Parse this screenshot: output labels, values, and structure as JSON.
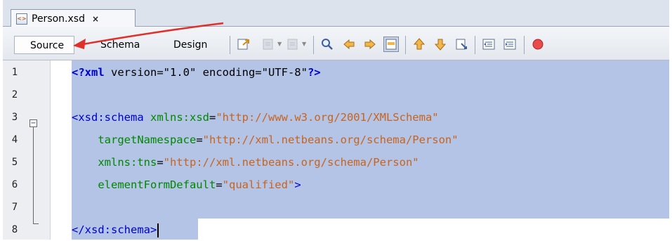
{
  "tab": {
    "title": "Person.xsd",
    "close": "×",
    "icon": "xsd-file-icon"
  },
  "toolbar": {
    "views": [
      "Source",
      "Schema",
      "Design"
    ],
    "active_view": "Source",
    "icons": [
      "go-to-source-icon",
      "back-icon",
      "forward-icon",
      "find-icon",
      "find-previous-icon",
      "find-next-icon",
      "toggle-highlight-icon",
      "previous-bookmark-icon",
      "next-bookmark-icon",
      "toggle-bookmark-icon",
      "shift-left-icon",
      "shift-right-icon",
      "record-macro-icon"
    ]
  },
  "editor": {
    "line_numbers": [
      "1",
      "2",
      "3",
      "4",
      "5",
      "6",
      "7",
      "8"
    ],
    "lines": [
      [
        {
          "t": "pi",
          "v": "<?xml"
        },
        {
          "t": "txt",
          "v": " version=\"1.0\" encoding=\"UTF-8\""
        },
        {
          "t": "pi",
          "v": "?>"
        }
      ],
      [],
      [
        {
          "t": "tag",
          "v": "<xsd:schema"
        },
        {
          "t": "txt",
          "v": " "
        },
        {
          "t": "attr",
          "v": "xmlns:xsd"
        },
        {
          "t": "txt",
          "v": "="
        },
        {
          "t": "val",
          "v": "\"http://www.w3.org/2001/XMLSchema\""
        }
      ],
      [
        {
          "t": "txt",
          "v": "    "
        },
        {
          "t": "attr",
          "v": "targetNamespace"
        },
        {
          "t": "txt",
          "v": "="
        },
        {
          "t": "val",
          "v": "\"http://xml.netbeans.org/schema/Person\""
        }
      ],
      [
        {
          "t": "txt",
          "v": "    "
        },
        {
          "t": "attr",
          "v": "xmlns:tns"
        },
        {
          "t": "txt",
          "v": "="
        },
        {
          "t": "val",
          "v": "\"http://xml.netbeans.org/schema/Person\""
        }
      ],
      [
        {
          "t": "txt",
          "v": "    "
        },
        {
          "t": "attr",
          "v": "elementFormDefault"
        },
        {
          "t": "txt",
          "v": "="
        },
        {
          "t": "val",
          "v": "\"qualified\""
        },
        {
          "t": "tag",
          "v": ">"
        }
      ],
      [],
      [
        {
          "t": "tag",
          "v": "</xsd:schema>"
        }
      ]
    ]
  },
  "colors": {
    "selection": "#b3c4e6",
    "tag": "#0000cc",
    "attr": "#008800",
    "value": "#c8641e",
    "annotation_arrow": "#e0302a"
  }
}
